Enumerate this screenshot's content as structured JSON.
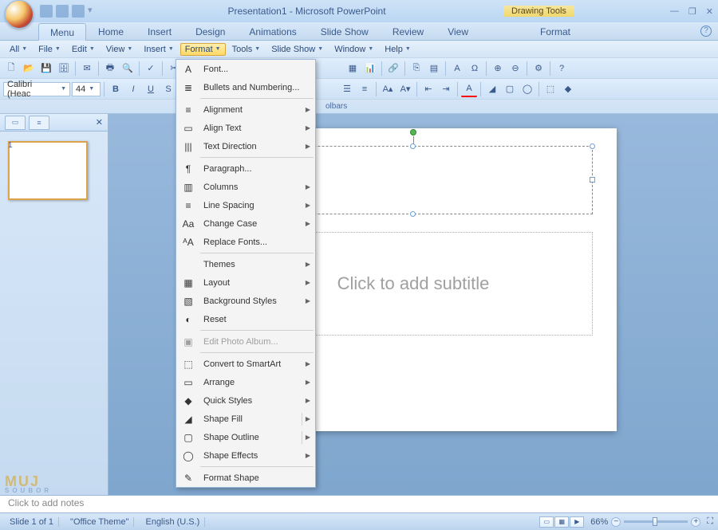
{
  "title": "Presentation1 - Microsoft PowerPoint",
  "tools_context": "Drawing Tools",
  "ribbon_tabs": [
    "Menu",
    "Home",
    "Insert",
    "Design",
    "Animations",
    "Slide Show",
    "Review",
    "View",
    "Format"
  ],
  "active_ribbon_tab": "Menu",
  "classic_menus": [
    "All",
    "File",
    "Edit",
    "View",
    "Insert",
    "Format",
    "Tools",
    "Slide Show",
    "Window",
    "Help"
  ],
  "open_menu": "Format",
  "font_combo": "Calibri (Heac",
  "font_size": "44",
  "collapse_hint": "olbars",
  "dropdown": [
    {
      "icon": "A",
      "label": "Font...",
      "type": "item"
    },
    {
      "icon": "≣",
      "label": "Bullets and Numbering...",
      "type": "item"
    },
    {
      "type": "sep"
    },
    {
      "icon": "≡",
      "label": "Alignment",
      "type": "sub"
    },
    {
      "icon": "▭",
      "label": "Align Text",
      "type": "sub"
    },
    {
      "icon": "|||",
      "label": "Text Direction",
      "type": "sub"
    },
    {
      "type": "sep"
    },
    {
      "icon": "¶",
      "label": "Paragraph...",
      "type": "item"
    },
    {
      "icon": "▥",
      "label": "Columns",
      "type": "sub"
    },
    {
      "icon": "≡",
      "label": "Line Spacing",
      "type": "sub"
    },
    {
      "icon": "Aa",
      "label": "Change Case",
      "type": "sub"
    },
    {
      "icon": "ᴬA",
      "label": "Replace Fonts...",
      "type": "item"
    },
    {
      "type": "sep"
    },
    {
      "icon": "",
      "label": "Themes",
      "type": "sub"
    },
    {
      "icon": "▦",
      "label": "Layout",
      "type": "sub"
    },
    {
      "icon": "▧",
      "label": "Background Styles",
      "type": "sub"
    },
    {
      "icon": "◐",
      "label": "Reset",
      "type": "item"
    },
    {
      "type": "sep"
    },
    {
      "icon": "▣",
      "label": "Edit Photo Album...",
      "type": "item",
      "disabled": true
    },
    {
      "type": "sep"
    },
    {
      "icon": "⬚",
      "label": "Convert to SmartArt",
      "type": "sub"
    },
    {
      "icon": "▭",
      "label": "Arrange",
      "type": "sub"
    },
    {
      "icon": "◆",
      "label": "Quick Styles",
      "type": "sub"
    },
    {
      "icon": "◢",
      "label": "Shape Fill",
      "type": "split"
    },
    {
      "icon": "▢",
      "label": "Shape Outline",
      "type": "split"
    },
    {
      "icon": "◯",
      "label": "Shape Effects",
      "type": "sub"
    },
    {
      "type": "sep"
    },
    {
      "icon": "✎",
      "label": "Format Shape",
      "type": "item"
    }
  ],
  "slide": {
    "subtitle_placeholder": "Click to add subtitle"
  },
  "notes_placeholder": "Click to add notes",
  "status": {
    "slide_info": "Slide 1 of 1",
    "theme": "\"Office Theme\"",
    "lang": "English (U.S.)",
    "zoom": "66%"
  },
  "thumb_number": "1",
  "watermark": {
    "line1": "MUJ",
    "line2": "SOUBOR"
  }
}
